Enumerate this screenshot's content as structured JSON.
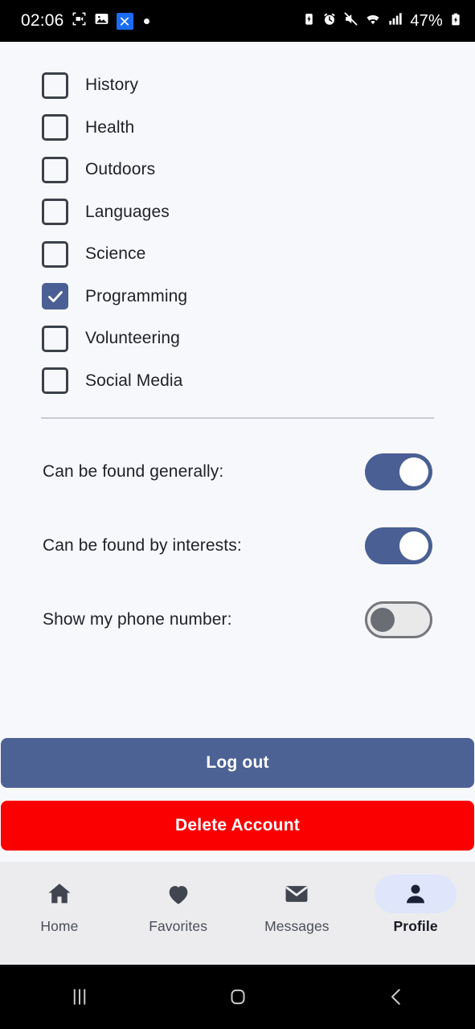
{
  "status_bar": {
    "time": "02:06",
    "battery_percent": "47%",
    "left_icons": [
      "screen-record-icon",
      "photo-icon",
      "x-app-badge-icon",
      "notification-dot-icon"
    ],
    "right_icons": [
      "battery-saver-icon",
      "alarm-icon",
      "volume-mute-icon",
      "wifi-icon",
      "signal-bars-icon",
      "battery-charging-icon"
    ]
  },
  "interests": {
    "items": [
      {
        "label": "History",
        "checked": false
      },
      {
        "label": "Health",
        "checked": false
      },
      {
        "label": "Outdoors",
        "checked": false
      },
      {
        "label": "Languages",
        "checked": false
      },
      {
        "label": "Science",
        "checked": false
      },
      {
        "label": "Programming",
        "checked": true
      },
      {
        "label": "Volunteering",
        "checked": false
      },
      {
        "label": "Social Media",
        "checked": false
      }
    ]
  },
  "privacy": {
    "toggles": [
      {
        "label": "Can be found generally:",
        "on": true
      },
      {
        "label": "Can be found by interests:",
        "on": true
      },
      {
        "label": "Show my phone number:",
        "on": false
      }
    ]
  },
  "actions": {
    "logout_label": "Log out",
    "delete_label": "Delete Account"
  },
  "bottom_nav": {
    "items": [
      {
        "label": "Home",
        "icon": "home-icon",
        "active": false
      },
      {
        "label": "Favorites",
        "icon": "heart-icon",
        "active": false
      },
      {
        "label": "Messages",
        "icon": "envelope-icon",
        "active": false
      },
      {
        "label": "Profile",
        "icon": "person-icon",
        "active": true
      }
    ]
  },
  "system_nav": {
    "recents_label": "recents-icon",
    "home_label": "home-square-icon",
    "back_label": "back-chevron-icon"
  },
  "colors": {
    "accent": "#4a6094",
    "danger": "#fa0000",
    "background": "#f7f8fc",
    "nav_background": "#ececef",
    "active_pill": "#dfe5fa"
  }
}
